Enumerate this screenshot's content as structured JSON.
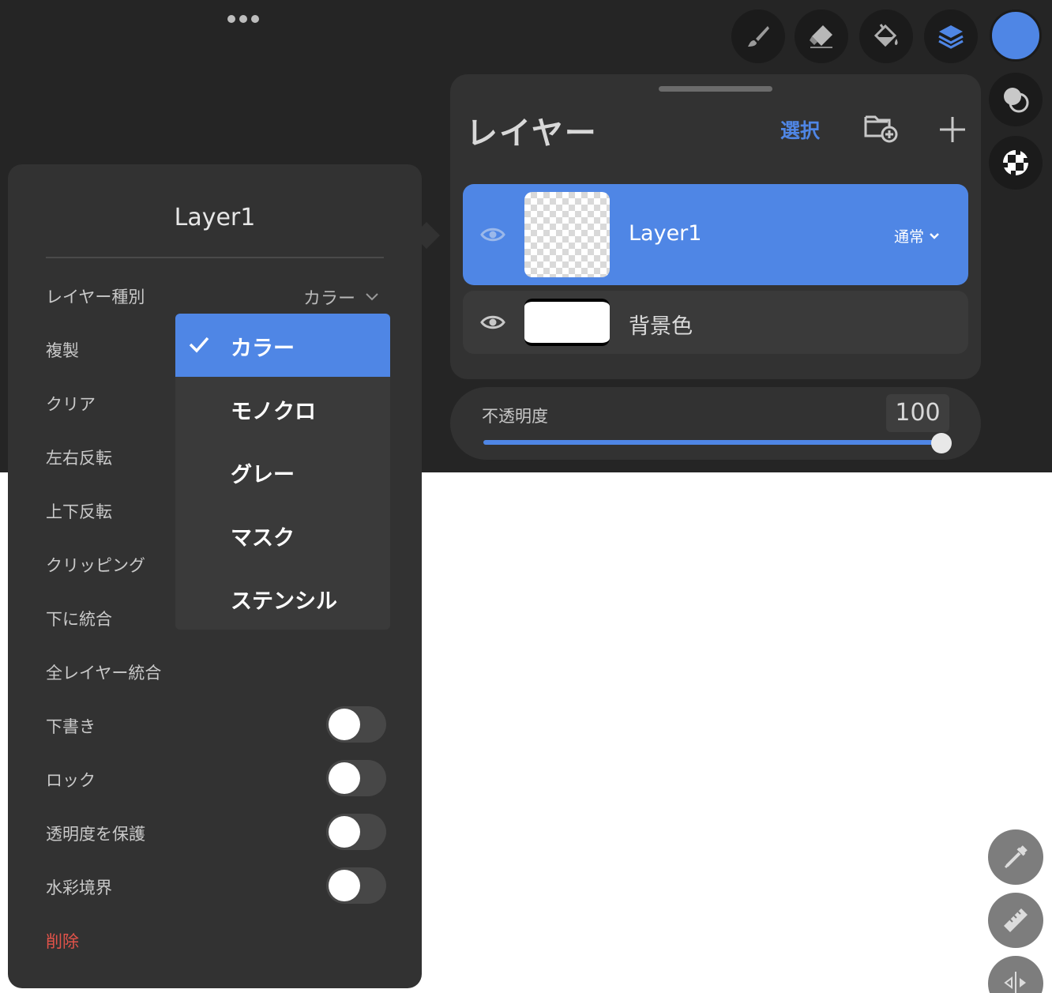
{
  "toolbar": {
    "tools": [
      {
        "name": "brush-icon",
        "label": "brush"
      },
      {
        "name": "eraser-icon",
        "label": "eraser"
      },
      {
        "name": "fill-bucket-icon",
        "label": "fill"
      },
      {
        "name": "layers-icon",
        "label": "layers"
      }
    ],
    "active_color": "#4f86e5"
  },
  "layers_panel": {
    "title": "レイヤー",
    "select_label": "選択",
    "layers": [
      {
        "name": "Layer1",
        "blend_mode": "通常",
        "selected": true,
        "visible": true
      },
      {
        "name": "背景色",
        "selected": false,
        "visible": true
      }
    ]
  },
  "opacity": {
    "label": "不透明度",
    "value": "100",
    "fraction": 1.0
  },
  "layer_menu": {
    "title": "Layer1",
    "type_label": "レイヤー種別",
    "type_value": "カラー",
    "items": [
      "複製",
      "クリア",
      "左右反転",
      "上下反転",
      "クリッピング",
      "下に統合",
      "全レイヤー統合"
    ],
    "toggles": [
      {
        "label": "下書き",
        "on": false
      },
      {
        "label": "ロック",
        "on": false
      },
      {
        "label": "透明度を保護",
        "on": false
      },
      {
        "label": "水彩境界",
        "on": false
      }
    ],
    "delete_label": "削除"
  },
  "type_dropdown": {
    "options": [
      "カラー",
      "モノクロ",
      "グレー",
      "マスク",
      "ステンシル"
    ],
    "selected_index": 0
  },
  "colors": {
    "accent": "#4f86e5",
    "panel": "#323232",
    "background": "#252525",
    "danger": "#e2534a"
  }
}
